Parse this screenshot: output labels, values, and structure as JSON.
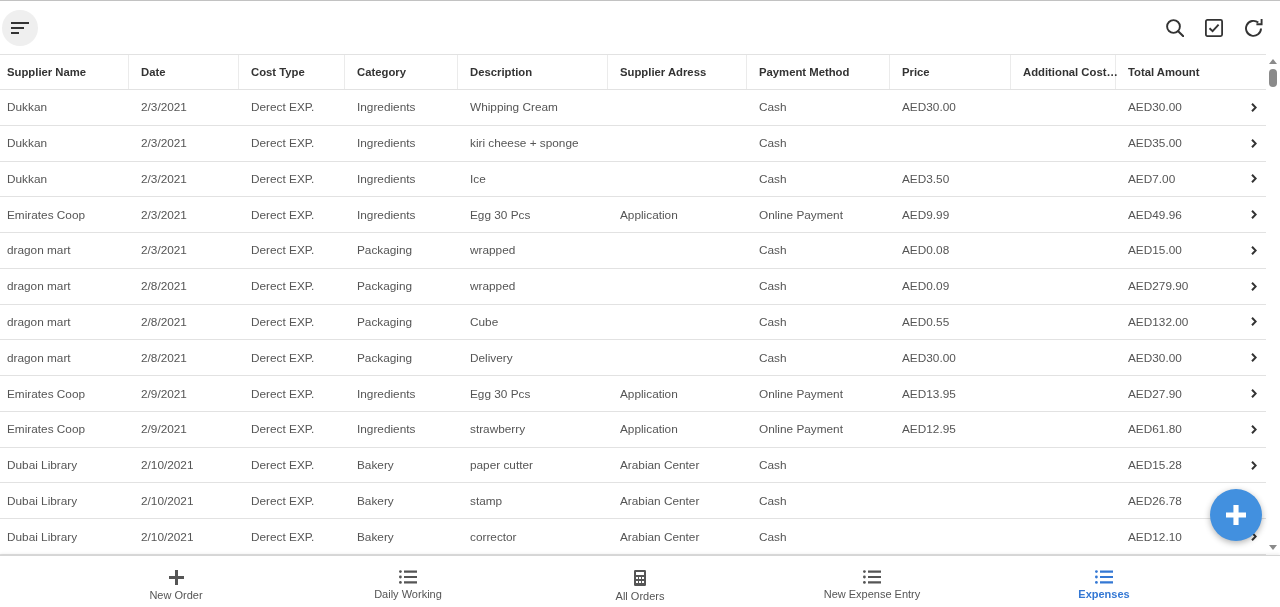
{
  "table": {
    "columns": [
      "Supplier Name",
      "Date",
      "Cost Type",
      "Category",
      "Description",
      "Supplier Adress",
      "Payment Method",
      "Price",
      "Additional Cost…",
      "Total Amount"
    ],
    "rows": [
      [
        "Dukkan",
        "2/3/2021",
        "Derect EXP.",
        "Ingredients",
        "Whipping Cream",
        null,
        "Cash",
        "AED30.00",
        null,
        "AED30.00"
      ],
      [
        "Dukkan",
        "2/3/2021",
        "Derect EXP.",
        "Ingredients",
        "kiri cheese + sponge",
        null,
        "Cash",
        null,
        null,
        "AED35.00"
      ],
      [
        "Dukkan",
        "2/3/2021",
        "Derect EXP.",
        "Ingredients",
        "Ice",
        null,
        "Cash",
        "AED3.50",
        null,
        "AED7.00"
      ],
      [
        "Emirates Coop",
        "2/3/2021",
        "Derect EXP.",
        "Ingredients",
        "Egg 30 Pcs",
        "Application",
        "Online Payment",
        "AED9.99",
        null,
        "AED49.96"
      ],
      [
        "dragon mart",
        "2/3/2021",
        "Derect EXP.",
        "Packaging",
        "wrapped",
        null,
        "Cash",
        "AED0.08",
        null,
        "AED15.00"
      ],
      [
        "dragon mart",
        "2/8/2021",
        "Derect EXP.",
        "Packaging",
        "wrapped",
        null,
        "Cash",
        "AED0.09",
        null,
        "AED279.90"
      ],
      [
        "dragon mart",
        "2/8/2021",
        "Derect EXP.",
        "Packaging",
        "Cube",
        null,
        "Cash",
        "AED0.55",
        null,
        "AED132.00"
      ],
      [
        "dragon mart",
        "2/8/2021",
        "Derect EXP.",
        "Packaging",
        "Delivery",
        null,
        "Cash",
        "AED30.00",
        null,
        "AED30.00"
      ],
      [
        "Emirates Coop",
        "2/9/2021",
        "Derect EXP.",
        "Ingredients",
        "Egg 30 Pcs",
        "Application",
        "Online Payment",
        "AED13.95",
        null,
        "AED27.90"
      ],
      [
        "Emirates Coop",
        "2/9/2021",
        "Derect EXP.",
        "Ingredients",
        "strawberry",
        "Application",
        "Online Payment",
        "AED12.95",
        null,
        "AED61.80"
      ],
      [
        "Dubai Library",
        "2/10/2021",
        "Derect EXP.",
        "Bakery",
        "paper cutter",
        "Arabian Center",
        "Cash",
        null,
        null,
        "AED15.28"
      ],
      [
        "Dubai Library",
        "2/10/2021",
        "Derect EXP.",
        "Bakery",
        "stamp",
        "Arabian Center",
        "Cash",
        null,
        null,
        "AED26.78"
      ],
      [
        "Dubai Library",
        "2/10/2021",
        "Derect EXP.",
        "Bakery",
        "corrector",
        "Arabian Center",
        "Cash",
        null,
        null,
        "AED12.10"
      ]
    ]
  },
  "bottom_nav": {
    "items": [
      {
        "kind": "plus",
        "label": "New Order",
        "selected": false
      },
      {
        "kind": "list",
        "label": "Daily Working",
        "selected": false
      },
      {
        "kind": "calculator",
        "label": "All Orders",
        "selected": false
      },
      {
        "kind": "list",
        "label": "New Expense Entry",
        "selected": false
      },
      {
        "kind": "list",
        "label": "Expenses",
        "selected": true
      }
    ]
  }
}
